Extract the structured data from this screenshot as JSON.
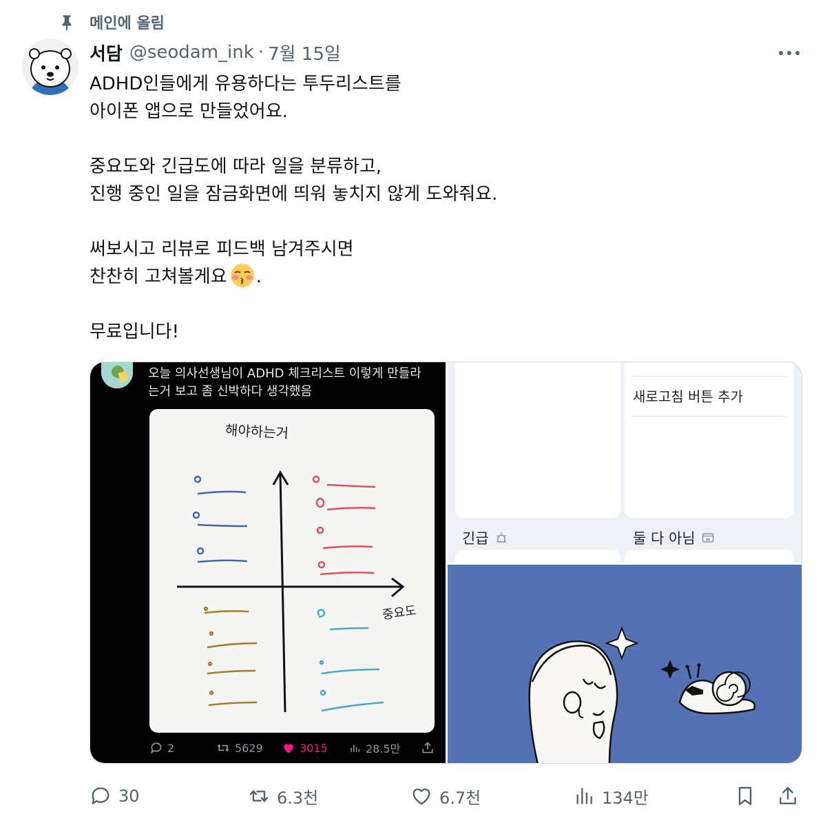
{
  "pinned": {
    "label": "메인에 올림"
  },
  "author": {
    "name": "서담",
    "handle": "@seodam_ink",
    "separator": "·",
    "date": "7월 15일"
  },
  "tweet": {
    "p1": [
      "ADHD인들에게 유용하다는 투두리스트를",
      "아이폰 앱으로 만들었어요."
    ],
    "p2": [
      "중요도와 긴급도에 따라 일을 분류하고,",
      "진행 중인 일을 잠금화면에 띄워 놓치지 않게 도와줘요."
    ],
    "p3": [
      "써보시고 리뷰로 피드백 남겨주시면",
      "찬찬히 고쳐볼게요"
    ],
    "p3_tail": ".",
    "p4": [
      "무료입니다!"
    ],
    "emoji": "kissing-face-with-closed-eyes"
  },
  "media": {
    "screenshot": {
      "text": [
        "오늘 의사선생님이 ADHD 체크리스트 이렇게 만들라",
        "는거 보고 좀 신박하다 생각했음"
      ],
      "note_title": "해야하는거",
      "note_axis": "중요도",
      "stats": {
        "replies": "2",
        "reposts": "5629",
        "likes": "3015",
        "views": "28.5만"
      }
    },
    "app": {
      "refresh_item": "새로고침 버튼 추가",
      "section_urgent": "긴급",
      "section_neither": "둘 다 아님"
    }
  },
  "actions": {
    "replies": "30",
    "reposts": "6.3천",
    "likes": "6.7천",
    "views": "134만"
  },
  "colors": {
    "text": "#0f1419",
    "secondary": "#536471",
    "like": "#f91880",
    "illustration_bg": "#5472b3"
  }
}
